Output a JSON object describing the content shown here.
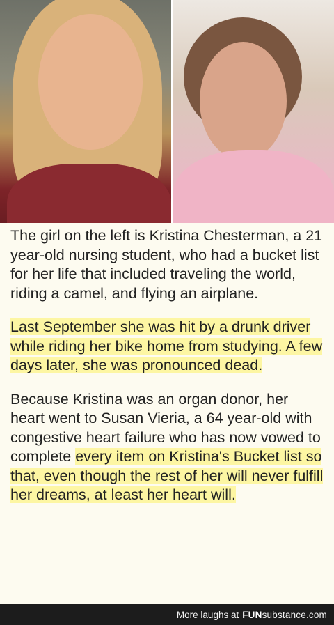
{
  "paragraphs": {
    "p1": "The girl on the left is Kristina Chesterman, a 21 year-old nursing student, who had a bucket list for her life that included traveling the world, riding a camel, and flying an airplane.",
    "p2": "Last September she was hit by a drunk driver while riding her bike home from studying. A few days later, she was pronounced dead.",
    "p3_plain": "Because Kristina was an organ donor, her heart went to Susan Vieria, a 64 year-old with congestive heart failure who has now vowed to complete ",
    "p3_highlight": "every item on Kristina's Bucket list so that, even though the rest of her will never fulfill her dreams, at least her heart will."
  },
  "footer": {
    "tagline": "More laughs at",
    "brand_fun": "FUN",
    "brand_rest": "substance",
    "brand_tld": ".com"
  },
  "colors": {
    "highlight": "#fdf6a3",
    "footer_bg": "#1c1c1c",
    "page_bg": "#fdfbf0"
  }
}
